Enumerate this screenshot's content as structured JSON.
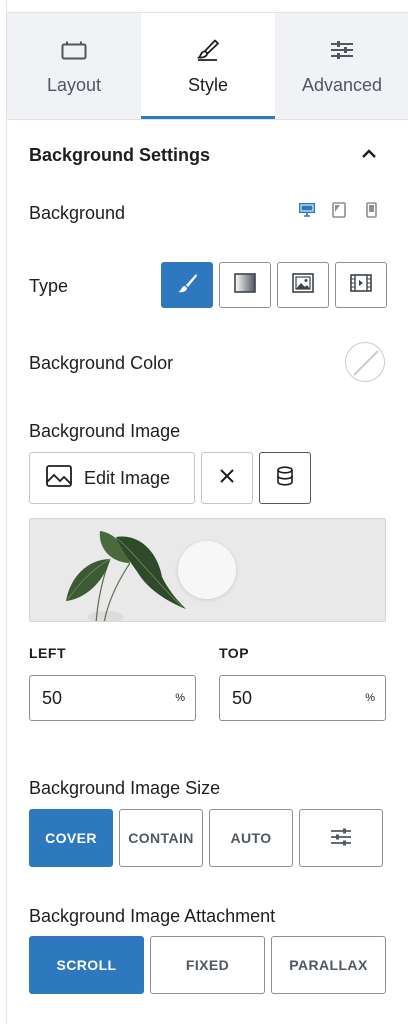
{
  "tabs": [
    {
      "label": "Layout",
      "icon": "layout-icon"
    },
    {
      "label": "Style",
      "icon": "brush-icon",
      "active": true
    },
    {
      "label": "Advanced",
      "icon": "sliders-icon"
    }
  ],
  "section": {
    "title": "Background Settings",
    "collapse_icon": "chevron-up-icon"
  },
  "background": {
    "label": "Background",
    "devices": [
      "desktop-icon",
      "tablet-icon",
      "mobile-icon"
    ],
    "active_device": "desktop"
  },
  "type": {
    "label": "Type",
    "options": [
      "classic",
      "gradient",
      "image",
      "video"
    ],
    "selected": "classic"
  },
  "background_color": {
    "label": "Background Color",
    "value": "none"
  },
  "background_image": {
    "label": "Background Image",
    "edit_label": "Edit Image",
    "remove_icon": "close-icon",
    "library_icon": "database-icon"
  },
  "position": {
    "left_label": "LEFT",
    "left_value": "50",
    "top_label": "TOP",
    "top_value": "50",
    "unit": "%"
  },
  "image_size": {
    "label": "Background Image Size",
    "options": [
      "COVER",
      "CONTAIN",
      "AUTO"
    ],
    "selected": "COVER",
    "custom_icon": "sliders-icon"
  },
  "attachment": {
    "label": "Background Image Attachment",
    "options": [
      "SCROLL",
      "FIXED",
      "PARALLAX"
    ],
    "selected": "SCROLL"
  },
  "colors": {
    "accent": "#2d78bf",
    "tab_bg": "#f0f2f6",
    "border": "#8c8f94"
  }
}
